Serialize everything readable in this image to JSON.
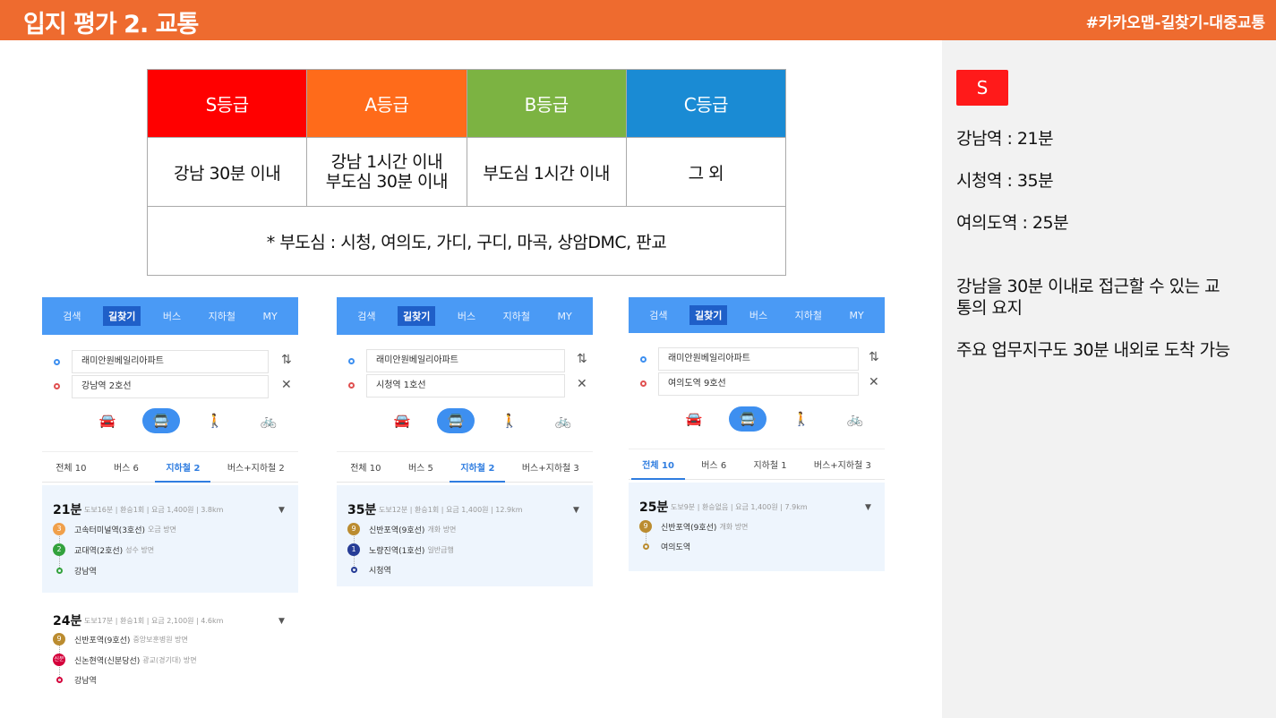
{
  "header": {
    "title": "입지 평가 2. 교통",
    "tag": "#카카오맵-길찾기-대중교통"
  },
  "grades": {
    "headers": [
      "S등급",
      "A등급",
      "B등급",
      "C등급"
    ],
    "criteria": [
      "강남 30분 이내",
      "강남 1시간 이내",
      "부도심 30분 이내",
      "부도심 1시간 이내",
      "그 외"
    ],
    "note": "* 부도심 : 시청, 여의도, 가디, 구디, 마곡, 상암DMC, 판교"
  },
  "side": {
    "badge": "S",
    "lines": [
      "강남역 : 21분",
      "시청역 : 35분",
      "여의도역 : 25분"
    ],
    "summary1": "강남을 30분 이내로 접근할 수 있는 교",
    "summary1b": "통의 요지",
    "summary2": "주요 업무지구도 30분 내외로 도착 가능"
  },
  "nav": [
    "검색",
    "길찾기",
    "버스",
    "지하철",
    "MY"
  ],
  "panels": [
    {
      "origin": "래미안원베일리아파트",
      "dest": "강남역 2호선",
      "tabs": [
        "전체 10",
        "버스 6",
        "지하철 2",
        "버스+지하철 2"
      ],
      "r1": {
        "time": "21분",
        "meta": "도보16분 | 환승1회 | 요금 1,400원 | 3.8km",
        "s1": "고속터미널역(3호선)",
        "s1d": "오금 방면",
        "s1b": "3",
        "s2": "교대역(2호선)",
        "s2d": "성수 방면",
        "s2b": "2",
        "end": "강남역"
      },
      "r2": {
        "time": "24분",
        "meta": "도보17분 | 환승1회 | 요금 2,100원 | 4.6km",
        "s1": "신반포역(9호선)",
        "s1d": "중앙보훈병원 방면",
        "s1b": "9",
        "s2": "신논현역(신분당선)",
        "s2d": "광교(경기대) 방면",
        "s2b": "신분",
        "end": "강남역"
      }
    },
    {
      "origin": "래미안원베일리아파트",
      "dest": "시청역 1호선",
      "tabs": [
        "전체 10",
        "버스 5",
        "지하철 2",
        "버스+지하철 3"
      ],
      "r1": {
        "time": "35분",
        "meta": "도보12분 | 환승1회 | 요금 1,400원 | 12.9km",
        "s1": "신반포역(9호선)",
        "s1d": "개화 방면",
        "s1b": "9",
        "s2": "노량진역(1호선)",
        "s2d": "일반급행",
        "s2b": "1",
        "end": "시청역"
      }
    },
    {
      "origin": "래미안원베일리아파트",
      "dest": "여의도역 9호선",
      "tabs": [
        "전체 10",
        "버스 6",
        "지하철 1",
        "버스+지하철 3"
      ],
      "r1": {
        "time": "25분",
        "meta": "도보9분 | 환승없음 | 요금 1,400원 | 7.9km",
        "s1": "신반포역(9호선)",
        "s1d": "개화 방면",
        "s1b": "9",
        "end": "여의도역"
      }
    }
  ],
  "icons": {
    "car": "🚘",
    "bus": "🚍",
    "walk": "🚶",
    "bike": "🚲",
    "swap": "⇅",
    "close": "✕",
    "caret": "▼"
  },
  "colors": {
    "line3": "#f0a04b",
    "line2": "#33a23d",
    "line9": "#bb8c30",
    "line1": "#263c96",
    "shinbundang": "#d4003b"
  }
}
